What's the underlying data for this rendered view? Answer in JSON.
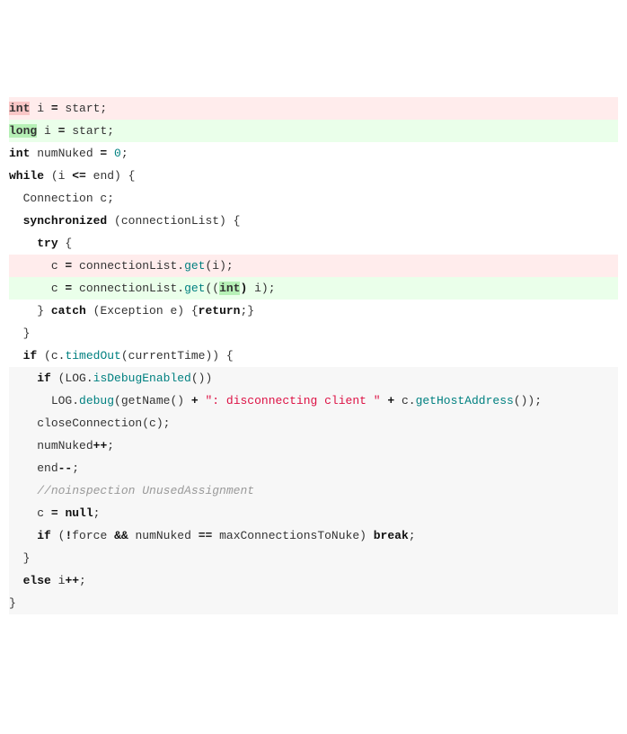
{
  "code_diff": {
    "language": "java",
    "lines": [
      {
        "type": "del",
        "indent": 0,
        "wrap": "line-del",
        "tokens": [
          {
            "t": "int",
            "cls": "kw-hl-del"
          },
          {
            "t": " i "
          },
          {
            "t": "=",
            "cls": "kw"
          },
          {
            "t": " start;"
          }
        ]
      },
      {
        "type": "add",
        "indent": 0,
        "wrap": "line-add",
        "tokens": [
          {
            "t": "long",
            "cls": "kw-hl-add"
          },
          {
            "t": " i "
          },
          {
            "t": "=",
            "cls": "kw"
          },
          {
            "t": " start;"
          }
        ]
      },
      {
        "type": "ctx",
        "indent": 0,
        "tokens": [
          {
            "t": "int",
            "cls": "kw"
          },
          {
            "t": " numNuked "
          },
          {
            "t": "=",
            "cls": "kw"
          },
          {
            "t": " "
          },
          {
            "t": "0",
            "cls": "num"
          },
          {
            "t": ";"
          }
        ]
      },
      {
        "type": "ctx",
        "indent": 0,
        "tokens": [
          {
            "t": "while",
            "cls": "kw"
          },
          {
            "t": " (i "
          },
          {
            "t": "<=",
            "cls": "kw"
          },
          {
            "t": " end) {"
          }
        ]
      },
      {
        "type": "ctx",
        "indent": 1,
        "tokens": [
          {
            "t": "Connection c;"
          }
        ]
      },
      {
        "type": "ctx",
        "indent": 1,
        "tokens": [
          {
            "t": "synchronized",
            "cls": "kw"
          },
          {
            "t": " (connectionList) {"
          }
        ]
      },
      {
        "type": "ctx",
        "indent": 2,
        "tokens": [
          {
            "t": "try",
            "cls": "kw"
          },
          {
            "t": " {"
          }
        ]
      },
      {
        "type": "del",
        "indent": 3,
        "wrap": "line-del",
        "tokens": [
          {
            "t": "c "
          },
          {
            "t": "=",
            "cls": "kw"
          },
          {
            "t": " connectionList."
          },
          {
            "t": "get",
            "cls": "method"
          },
          {
            "t": "(i);"
          }
        ]
      },
      {
        "type": "add",
        "indent": 3,
        "wrap": "line-add",
        "tokens": [
          {
            "t": "c "
          },
          {
            "t": "=",
            "cls": "kw"
          },
          {
            "t": " connectionList."
          },
          {
            "t": "get",
            "cls": "method"
          },
          {
            "t": "(("
          },
          {
            "t": "int",
            "cls": "kw-hl-add"
          },
          {
            "t": ")",
            "cls": "kw"
          },
          {
            "t": " i);"
          }
        ]
      },
      {
        "type": "ctx",
        "indent": 2,
        "tokens": [
          {
            "t": "} "
          },
          {
            "t": "catch",
            "cls": "kw"
          },
          {
            "t": " (Exception e) {"
          },
          {
            "t": "return",
            "cls": "kw"
          },
          {
            "t": ";}"
          }
        ]
      },
      {
        "type": "ctx",
        "indent": 1,
        "tokens": [
          {
            "t": "}"
          }
        ]
      },
      {
        "type": "ctx",
        "indent": 1,
        "tokens": [
          {
            "t": "if",
            "cls": "kw"
          },
          {
            "t": " (c."
          },
          {
            "t": "timedOut",
            "cls": "method"
          },
          {
            "t": "(currentTime)) {"
          }
        ]
      },
      {
        "type": "ctxlow",
        "indent": 2,
        "wrap": "line-ctx",
        "tokens": [
          {
            "t": "if",
            "cls": "kw"
          },
          {
            "t": " (LOG."
          },
          {
            "t": "isDebugEnabled",
            "cls": "method"
          },
          {
            "t": "())"
          }
        ]
      },
      {
        "type": "ctxlow",
        "indent": 3,
        "wrap": "line-ctx",
        "tokens": [
          {
            "t": "LOG."
          },
          {
            "t": "debug",
            "cls": "method"
          },
          {
            "t": "(getName() "
          },
          {
            "t": "+",
            "cls": "kw"
          },
          {
            "t": " "
          },
          {
            "t": "\": disconnecting client \"",
            "cls": "str"
          },
          {
            "t": " "
          },
          {
            "t": "+",
            "cls": "kw"
          },
          {
            "t": " c."
          },
          {
            "t": "getHostAddress",
            "cls": "method"
          },
          {
            "t": "());"
          }
        ]
      },
      {
        "type": "ctxlow",
        "indent": 2,
        "wrap": "line-ctx",
        "tokens": [
          {
            "t": "closeConnection(c);"
          }
        ]
      },
      {
        "type": "ctxlow",
        "indent": 2,
        "wrap": "line-ctx",
        "tokens": [
          {
            "t": "numNuked"
          },
          {
            "t": "++",
            "cls": "kw"
          },
          {
            "t": ";"
          }
        ]
      },
      {
        "type": "ctxlow",
        "indent": 2,
        "wrap": "line-ctx",
        "tokens": [
          {
            "t": "end"
          },
          {
            "t": "--",
            "cls": "kw"
          },
          {
            "t": ";"
          }
        ]
      },
      {
        "type": "ctxlow",
        "indent": 2,
        "wrap": "line-ctx",
        "tokens": [
          {
            "t": "//noinspection UnusedAssignment",
            "cls": "comment"
          }
        ]
      },
      {
        "type": "ctxlow",
        "indent": 2,
        "wrap": "line-ctx",
        "tokens": [
          {
            "t": "c "
          },
          {
            "t": "=",
            "cls": "kw"
          },
          {
            "t": " "
          },
          {
            "t": "null",
            "cls": "kw"
          },
          {
            "t": ";"
          }
        ]
      },
      {
        "type": "ctxlow",
        "indent": 2,
        "wrap": "line-ctx",
        "tokens": [
          {
            "t": "if",
            "cls": "kw"
          },
          {
            "t": " ("
          },
          {
            "t": "!",
            "cls": "kw"
          },
          {
            "t": "force "
          },
          {
            "t": "&&",
            "cls": "kw"
          },
          {
            "t": " numNuked "
          },
          {
            "t": "==",
            "cls": "kw"
          },
          {
            "t": " maxConnectionsToNuke) "
          },
          {
            "t": "break",
            "cls": "kw"
          },
          {
            "t": ";"
          }
        ]
      },
      {
        "type": "ctxlow",
        "indent": 1,
        "wrap": "line-ctx",
        "tokens": [
          {
            "t": "}"
          }
        ]
      },
      {
        "type": "ctxlow",
        "indent": 1,
        "wrap": "line-ctx",
        "tokens": [
          {
            "t": "else",
            "cls": "kw"
          },
          {
            "t": " i"
          },
          {
            "t": "++",
            "cls": "kw"
          },
          {
            "t": ";"
          }
        ]
      },
      {
        "type": "ctxlow",
        "indent": 0,
        "wrap": "line-ctx",
        "tokens": [
          {
            "t": "}"
          }
        ]
      }
    ]
  }
}
